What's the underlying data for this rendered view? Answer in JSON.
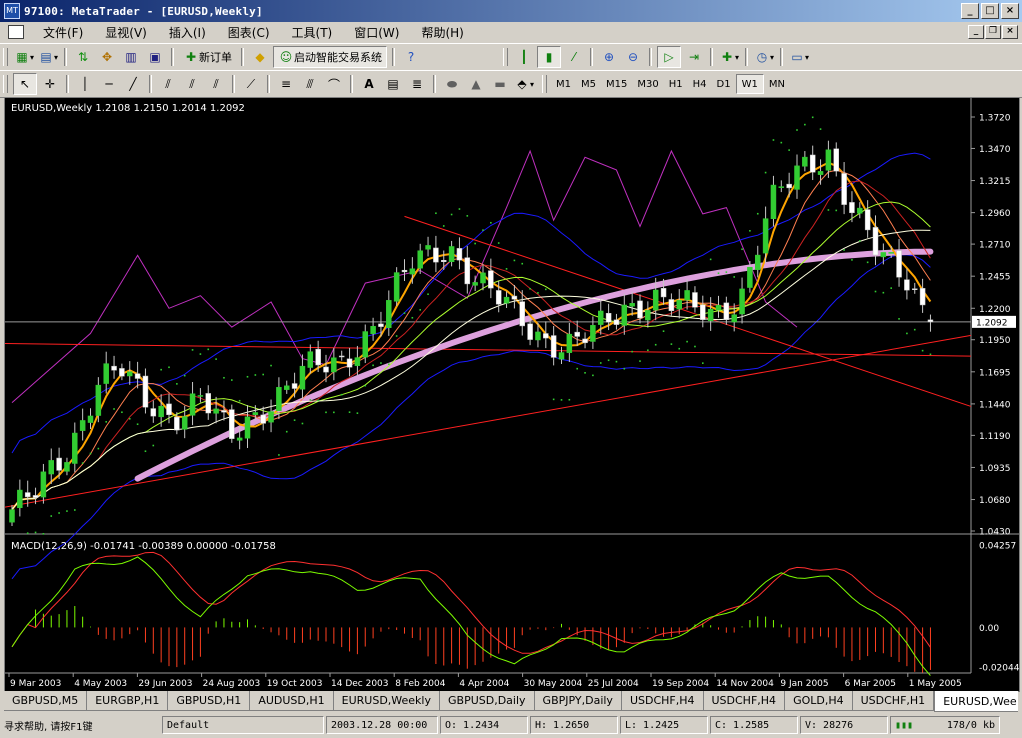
{
  "window": {
    "title": "97100: MetaTrader - [EURUSD,Weekly]",
    "app_icon": "MT"
  },
  "menu": [
    "文件(F)",
    "显视(V)",
    "插入(I)",
    "图表(C)",
    "工具(T)",
    "窗口(W)",
    "帮助(H)"
  ],
  "toolbar1": {
    "new_order_label": "新订单",
    "expert_label": "启动智能交易系统"
  },
  "timeframes": [
    "M1",
    "M5",
    "M15",
    "M30",
    "H1",
    "H4",
    "D1",
    "W1",
    "MN"
  ],
  "active_timeframe": "W1",
  "chart": {
    "header": "EURUSD,Weekly  1.2108 1.2150 1.2014 1.2092",
    "price_axis": [
      "1.3720",
      "1.3470",
      "1.3215",
      "1.2960",
      "1.2710",
      "1.2455",
      "1.2200",
      "1.1950",
      "1.1695",
      "1.1440",
      "1.1190",
      "1.0935",
      "1.0680",
      "1.0430"
    ],
    "current_price": "1.2092",
    "macd_header": "MACD(12,26,9) -0.01741 -0.00389 0.00000 -0.01758",
    "macd_axis": [
      "0.04257",
      "0.00",
      "-0.02044"
    ],
    "date_axis": [
      "9 Mar 2003",
      "4 May 2003",
      "29 Jun 2003",
      "24 Aug 2003",
      "19 Oct 2003",
      "14 Dec 2003",
      "8 Feb 2004",
      "4 Apr 2004",
      "30 May 2004",
      "25 Jul 2004",
      "19 Sep 2004",
      "14 Nov 2004",
      "9 Jan 2005",
      "6 Mar 2005",
      "1 May 2005"
    ],
    "colors": {
      "bull": "#32cd32",
      "bear": "#ffffff",
      "ma_thick": "#dda0dd",
      "ma_orange": "#ffa500",
      "bollinger": "#1a1aff",
      "ichimoku": "#c030c0",
      "trend": "#ff2020",
      "psar": "#32cd32",
      "macd_signal": "#ff3030",
      "macd_main": "#7cfc00"
    }
  },
  "tabs": [
    "GBPUSD,M5",
    "EURGBP,H1",
    "GBPUSD,H1",
    "AUDUSD,H1",
    "EURUSD,Weekly",
    "GBPUSD,Daily",
    "GBPJPY,Daily",
    "USDCHF,H4",
    "USDCHF,H4",
    "GOLD,H4",
    "USDCHF,H1",
    "EURUSD,Wee"
  ],
  "active_tab": 11,
  "status": {
    "help": "寻求帮助, 请按F1键",
    "profile": "Default",
    "datetime": "2003.12.28 00:00",
    "open": "O: 1.2434",
    "high": "H: 1.2650",
    "low": "L: 1.2425",
    "close": "C: 1.2585",
    "volume": "V: 28276",
    "traffic": "178/0 kb"
  }
}
